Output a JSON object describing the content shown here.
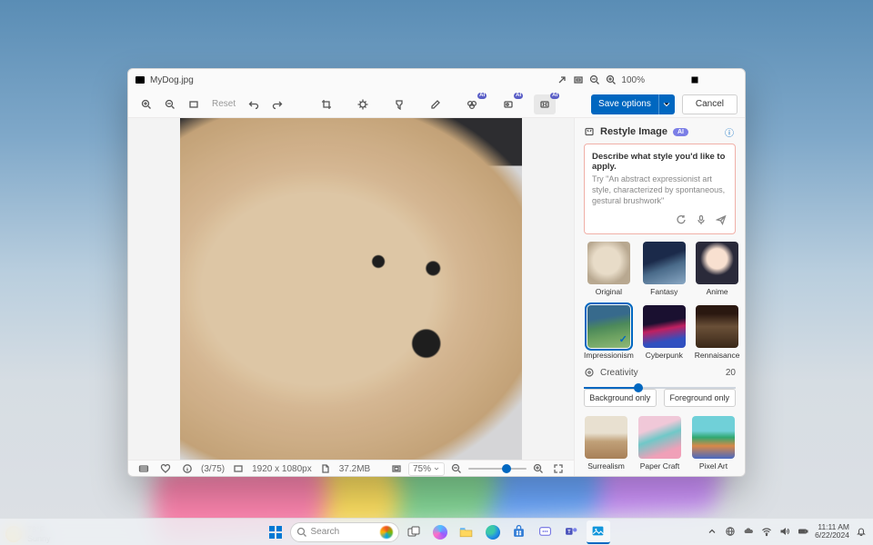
{
  "window": {
    "filename": "MyDog.jpg",
    "zoom_label": "100%"
  },
  "toolbar": {
    "reset_label": "Reset",
    "save_label": "Save options",
    "cancel_label": "Cancel"
  },
  "statusbar": {
    "page_count": "(3/75)",
    "dimensions": "1920 x 1080px",
    "file_size": "37.2MB",
    "zoom_select": "75%"
  },
  "panel": {
    "title": "Restyle Image",
    "ai_pill": "AI",
    "prompt_title": "Describe what style you'd like to apply.",
    "prompt_hint": "Try \"An abstract expressionist art style, characterized by spontaneous, gestural brushwork\"",
    "creativity_label": "Creativity",
    "creativity_value": "20",
    "bg_only": "Background only",
    "fg_only": "Foreground only",
    "styles": {
      "original": "Original",
      "fantasy": "Fantasy",
      "anime": "Anime",
      "impressionism": "Impressionism",
      "cyberpunk": "Cyberpunk",
      "renaissance": "Rennaisance",
      "surrealism": "Surrealism",
      "papercraft": "Paper Craft",
      "pixelart": "Pixel Art"
    }
  },
  "taskbar": {
    "search_placeholder": "Search",
    "weather_temp": "78°F",
    "weather_desc": "Sunny",
    "clock_time": "11:11 AM",
    "clock_date": "6/22/2024"
  }
}
